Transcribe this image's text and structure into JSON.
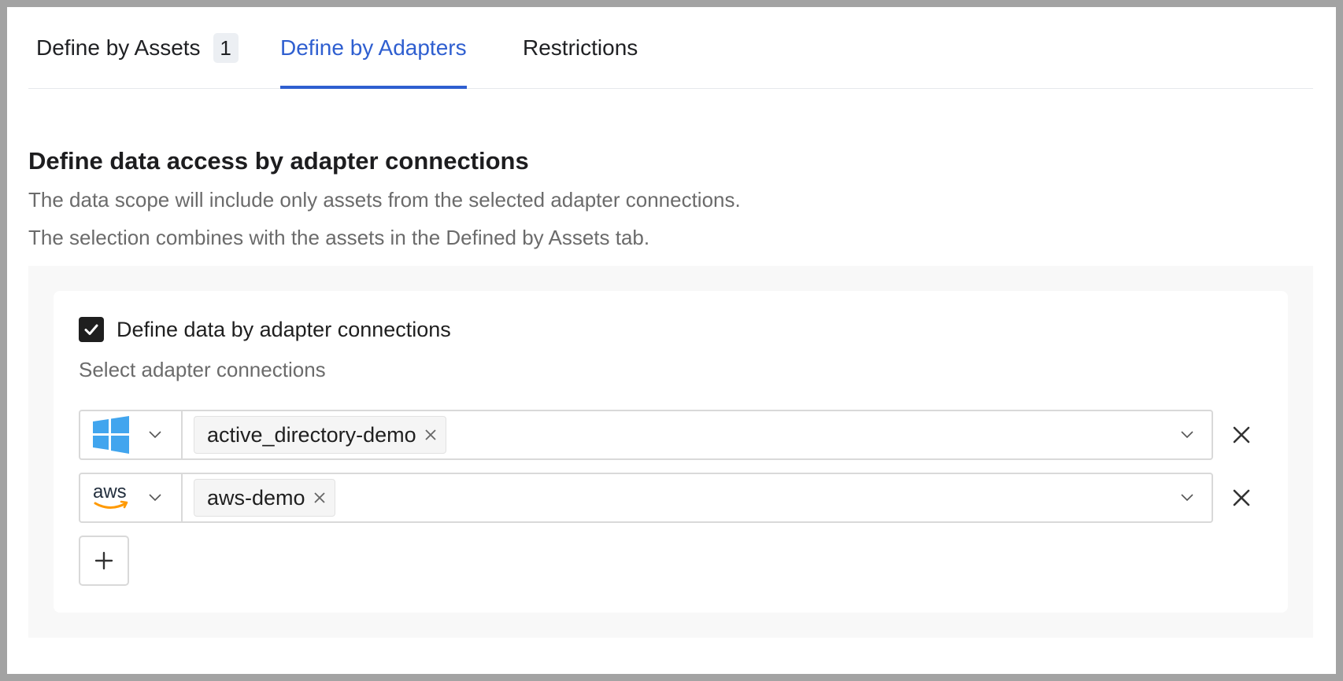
{
  "tabs": [
    {
      "label": "Define by Assets",
      "badge": "1",
      "active": false
    },
    {
      "label": "Define by Adapters",
      "active": true
    },
    {
      "label": "Restrictions",
      "active": false
    }
  ],
  "section": {
    "title": "Define data access by adapter connections",
    "description_1": "The data scope will include only assets from the selected adapter connections.",
    "description_2": "The selection combines with the assets in the Defined by Assets tab."
  },
  "adapters": {
    "checkbox_label": "Define data by adapter connections",
    "checked": true,
    "select_label": "Select adapter connections",
    "rows": [
      {
        "adapter_icon": "windows-logo",
        "connection": "active_directory-demo"
      },
      {
        "adapter_icon": "aws-logo",
        "connection": "aws-demo"
      }
    ],
    "add_icon": "plus-icon"
  },
  "colors": {
    "accent": "#2f5fd0",
    "windows_blue": "#41a5ee",
    "aws_orange": "#ff9900",
    "checkbox": "#1f1f1f"
  }
}
